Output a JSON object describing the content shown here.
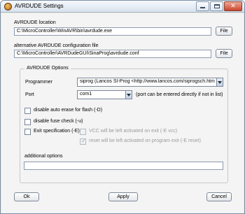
{
  "window": {
    "title": "AVRDUDE Settings",
    "close_glyph": "✕"
  },
  "avrdude_location": {
    "label": "AVRDUDE location",
    "value": "C:\\MicroController\\WinAVR\\bin\\avrdude.exe",
    "file_button": "File"
  },
  "config_file": {
    "label": "alternative AVRDUDE configuration file",
    "value": "C:\\MicroController\\AVRDudeGUI\\SinaProg\\avrdude.conf",
    "file_button": "File"
  },
  "options": {
    "group_title": "AVRDUDE Options",
    "programmer": {
      "label": "Programmer",
      "value": "siprog (Lancos SI-Prog <http://www.lancos.com/siprogsch.html>)"
    },
    "port": {
      "label": "Port",
      "value": "com1",
      "hint": "(port can be entered directly if not in list)"
    },
    "disable_auto_erase": {
      "label": "disable auto erase for flash (-D)",
      "checked": false
    },
    "disable_fuse_check": {
      "label": "disable fuse check (-u)",
      "checked": false
    },
    "exit_specification": {
      "label": "Exit specification (-E)",
      "checked": false
    },
    "vcc_option": {
      "label": "VCC will be left activated on exit (-E vcc)",
      "checked": false,
      "enabled": false
    },
    "reset_option": {
      "label": "reset will be left activated on program exit (-E reset)",
      "checked": true,
      "enabled": false
    },
    "additional_options": {
      "label": "additional options",
      "value": ""
    }
  },
  "footer": {
    "ok": "Ok",
    "apply": "Apply",
    "cancel": "Cancel"
  }
}
